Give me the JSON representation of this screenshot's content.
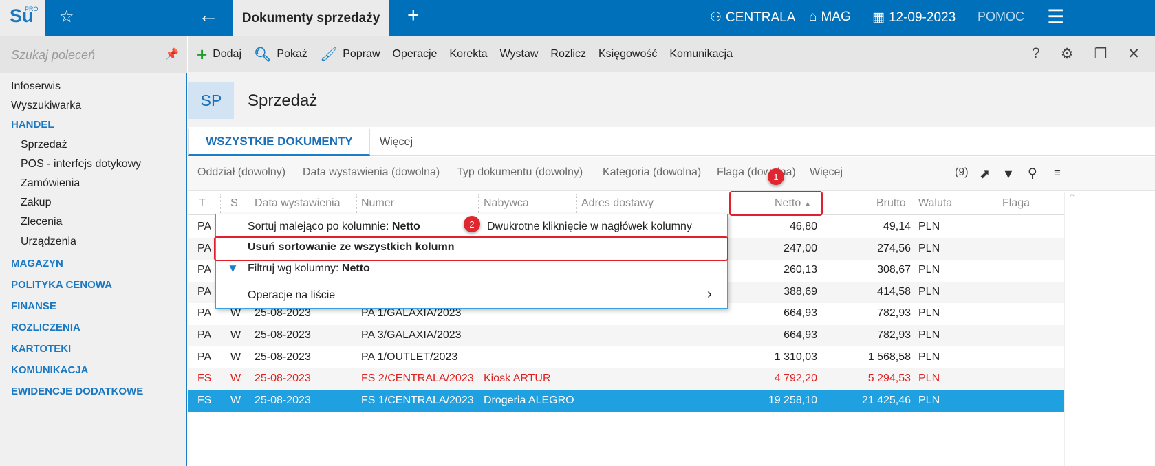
{
  "app": {
    "logo": "Su",
    "logo_sup": "PRO",
    "tab_title": "Dokumenty sprzedaży",
    "branch": "CENTRALA",
    "warehouse": "MAG",
    "date": "12-09-2023",
    "help": "POMOC"
  },
  "sidebar": {
    "search_placeholder": "Szukaj poleceń",
    "items": [
      {
        "label": "Infoserwis",
        "type": "item"
      },
      {
        "label": "Wyszukiwarka",
        "type": "item"
      },
      {
        "label": "HANDEL",
        "type": "head"
      },
      {
        "label": "Sprzedaż",
        "type": "sub"
      },
      {
        "label": "POS - interfejs dotykowy",
        "type": "sub"
      },
      {
        "label": "Zamówienia",
        "type": "sub"
      },
      {
        "label": "Zakup",
        "type": "sub"
      },
      {
        "label": "Zlecenia",
        "type": "sub"
      },
      {
        "label": "Urządzenia",
        "type": "sub"
      },
      {
        "label": "MAGAZYN",
        "type": "head"
      },
      {
        "label": "POLITYKA CENOWA",
        "type": "head"
      },
      {
        "label": "FINANSE",
        "type": "head"
      },
      {
        "label": "ROZLICZENIA",
        "type": "head"
      },
      {
        "label": "KARTOTEKI",
        "type": "head"
      },
      {
        "label": "KOMUNIKACJA",
        "type": "head"
      },
      {
        "label": "EWIDENCJE DODATKOWE",
        "type": "head"
      }
    ]
  },
  "toolbar": {
    "add": "Dodaj",
    "show": "Pokaż",
    "edit": "Popraw",
    "operations": "Operacje",
    "correction": "Korekta",
    "issue": "Wystaw",
    "settle": "Rozlicz",
    "accounting": "Księgowość",
    "communication": "Komunikacja"
  },
  "header": {
    "badge": "SP",
    "title": "Sprzedaż"
  },
  "tabs": {
    "all": "WSZYSTKIE DOKUMENTY",
    "more": "Więcej"
  },
  "filters": {
    "branch": "Oddział (dowolny)",
    "date": "Data wystawienia (dowolna)",
    "doctype": "Typ dokumentu (dowolny)",
    "category": "Kategoria (dowolna)",
    "flag": "Flaga (dowolna)",
    "more": "Więcej",
    "count": "(9)"
  },
  "columns": {
    "t": "T",
    "s": "S",
    "date": "Data wystawienia",
    "number": "Numer",
    "buyer": "Nabywca",
    "address": "Adres dostawy",
    "net": "Netto",
    "gross": "Brutto",
    "currency": "Waluta",
    "flag": "Flaga"
  },
  "rows": [
    {
      "t": "PA",
      "s": "",
      "date": "",
      "number": "",
      "buyer": "",
      "net": "46,80",
      "gross": "49,14",
      "currency": "PLN",
      "style": ""
    },
    {
      "t": "PA",
      "s": "",
      "date": "",
      "number": "",
      "buyer": "",
      "net": "247,00",
      "gross": "274,56",
      "currency": "PLN",
      "style": "alt"
    },
    {
      "t": "PA",
      "s": "",
      "date": "",
      "number": "",
      "buyer": "",
      "net": "260,13",
      "gross": "308,67",
      "currency": "PLN",
      "style": ""
    },
    {
      "t": "PA",
      "s": "",
      "date": "",
      "number": "",
      "buyer": "",
      "net": "388,69",
      "gross": "414,58",
      "currency": "PLN",
      "style": "alt"
    },
    {
      "t": "PA",
      "s": "W",
      "date": "25-08-2023",
      "number": "PA 1/GALAXIA/2023",
      "buyer": "",
      "net": "664,93",
      "gross": "782,93",
      "currency": "PLN",
      "style": ""
    },
    {
      "t": "PA",
      "s": "W",
      "date": "25-08-2023",
      "number": "PA 3/GALAXIA/2023",
      "buyer": "",
      "net": "664,93",
      "gross": "782,93",
      "currency": "PLN",
      "style": "alt"
    },
    {
      "t": "PA",
      "s": "W",
      "date": "25-08-2023",
      "number": "PA 1/OUTLET/2023",
      "buyer": "",
      "net": "1 310,03",
      "gross": "1 568,58",
      "currency": "PLN",
      "style": ""
    },
    {
      "t": "FS",
      "s": "W",
      "date": "25-08-2023",
      "number": "FS 2/CENTRALA/2023",
      "buyer": "Kiosk ARTUR",
      "net": "4 792,20",
      "gross": "5 294,53",
      "currency": "PLN",
      "style": "alt red"
    },
    {
      "t": "FS",
      "s": "W",
      "date": "25-08-2023",
      "number": "FS 1/CENTRALA/2023",
      "buyer": "Drogeria ALEGRO",
      "net": "19 258,10",
      "gross": "21 425,46",
      "currency": "PLN",
      "style": "sel"
    }
  ],
  "menu": {
    "sort_desc": "Sortuj malejąco po kolumnie: ",
    "sort_col": "Netto",
    "sort_hint": "Dwukrotne kliknięcie w nagłówek kolumny",
    "remove_sort": "Usuń sortowanie ze wszystkich kolumn",
    "filter": "Filtruj wg kolumny: ",
    "filter_col": "Netto",
    "list_ops": "Operacje na liście",
    "chevron": "›"
  },
  "annotations": {
    "one": "1",
    "two": "2"
  }
}
